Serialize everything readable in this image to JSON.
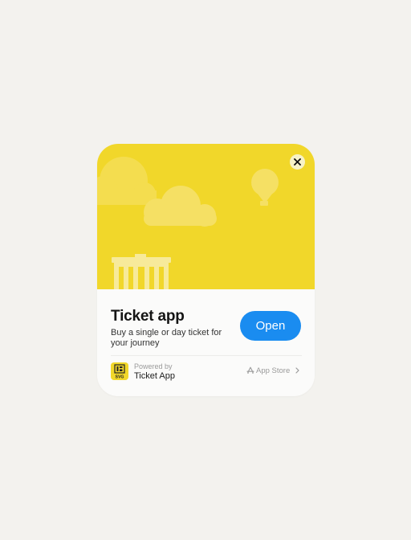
{
  "clip": {
    "title": "Ticket app",
    "subtitle": "Buy a single or day ticket for your journey",
    "open_label": "Open",
    "close_icon": "close-icon",
    "hero_color": "#f1d72a",
    "accent_color": "#1a8cf0"
  },
  "footer": {
    "powered_label": "Powered by",
    "powered_name": "Ticket App",
    "app_icon_text": "SVG",
    "store_label": "App Store",
    "store_icon": "app-store-icon",
    "chevron_icon": "chevron-right-icon"
  }
}
